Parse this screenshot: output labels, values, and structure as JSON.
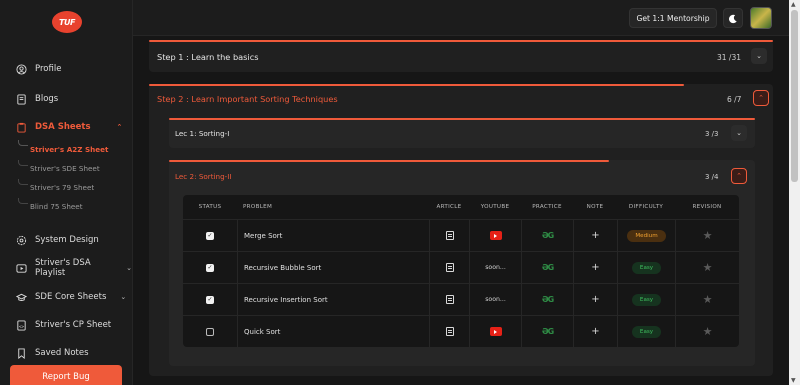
{
  "brand": {
    "logo_text": "TUF"
  },
  "header": {
    "mentorship_label": "Get 1:1 Mentorship"
  },
  "sidebar": {
    "items": [
      {
        "label": "Profile",
        "icon": "user-circle-icon"
      },
      {
        "label": "Blogs",
        "icon": "document-icon"
      },
      {
        "label": "DSA Sheets",
        "icon": "clipboard-icon",
        "active": true
      },
      {
        "label": "System Design",
        "icon": "gear-network-icon"
      },
      {
        "label": "Striver's DSA Playlist",
        "icon": "play-icon"
      },
      {
        "label": "SDE Core Sheets",
        "icon": "graduation-cap-icon"
      },
      {
        "label": "Striver's CP Sheet",
        "icon": "code-file-icon"
      },
      {
        "label": "Saved Notes",
        "icon": "bookmark-icon"
      }
    ],
    "sub_items": [
      {
        "label": "Striver's A2Z Sheet",
        "active": true
      },
      {
        "label": "Striver's SDE Sheet"
      },
      {
        "label": "Striver's 79 Sheet"
      },
      {
        "label": "Blind 75 Sheet"
      }
    ],
    "report_bug": "Report Bug"
  },
  "steps": [
    {
      "title": "Step 1 : Learn the basics",
      "count": "31 /31",
      "expanded": false,
      "progress": 1.0
    },
    {
      "title": "Step 2 : Learn Important Sorting Techniques",
      "count": "6 /7",
      "expanded": true,
      "progress": 0.857
    }
  ],
  "lectures": [
    {
      "title": "Lec 1: Sorting-I",
      "count": "3 /3",
      "expanded": false,
      "progress": 1.0
    },
    {
      "title": "Lec 2: Sorting-II",
      "count": "3 /4",
      "expanded": true,
      "progress": 0.75
    }
  ],
  "table": {
    "headers": [
      "STATUS",
      "PROBLEM",
      "ARTICLE",
      "YOUTUBE",
      "PRACTICE",
      "NOTE",
      "DIFFICULTY",
      "REVISION"
    ],
    "rows": [
      {
        "done": true,
        "problem": "Merge Sort",
        "youtube": "video",
        "difficulty": "Medium"
      },
      {
        "done": true,
        "problem": "Recursive Bubble Sort",
        "youtube": "soon...",
        "difficulty": "Easy"
      },
      {
        "done": true,
        "problem": "Recursive Insertion Sort",
        "youtube": "soon...",
        "difficulty": "Easy"
      },
      {
        "done": false,
        "problem": "Quick Sort",
        "youtube": "video",
        "difficulty": "Easy"
      }
    ]
  },
  "colors": {
    "accent": "#ef5a3a",
    "background": "#161616",
    "panel": "#202020"
  }
}
